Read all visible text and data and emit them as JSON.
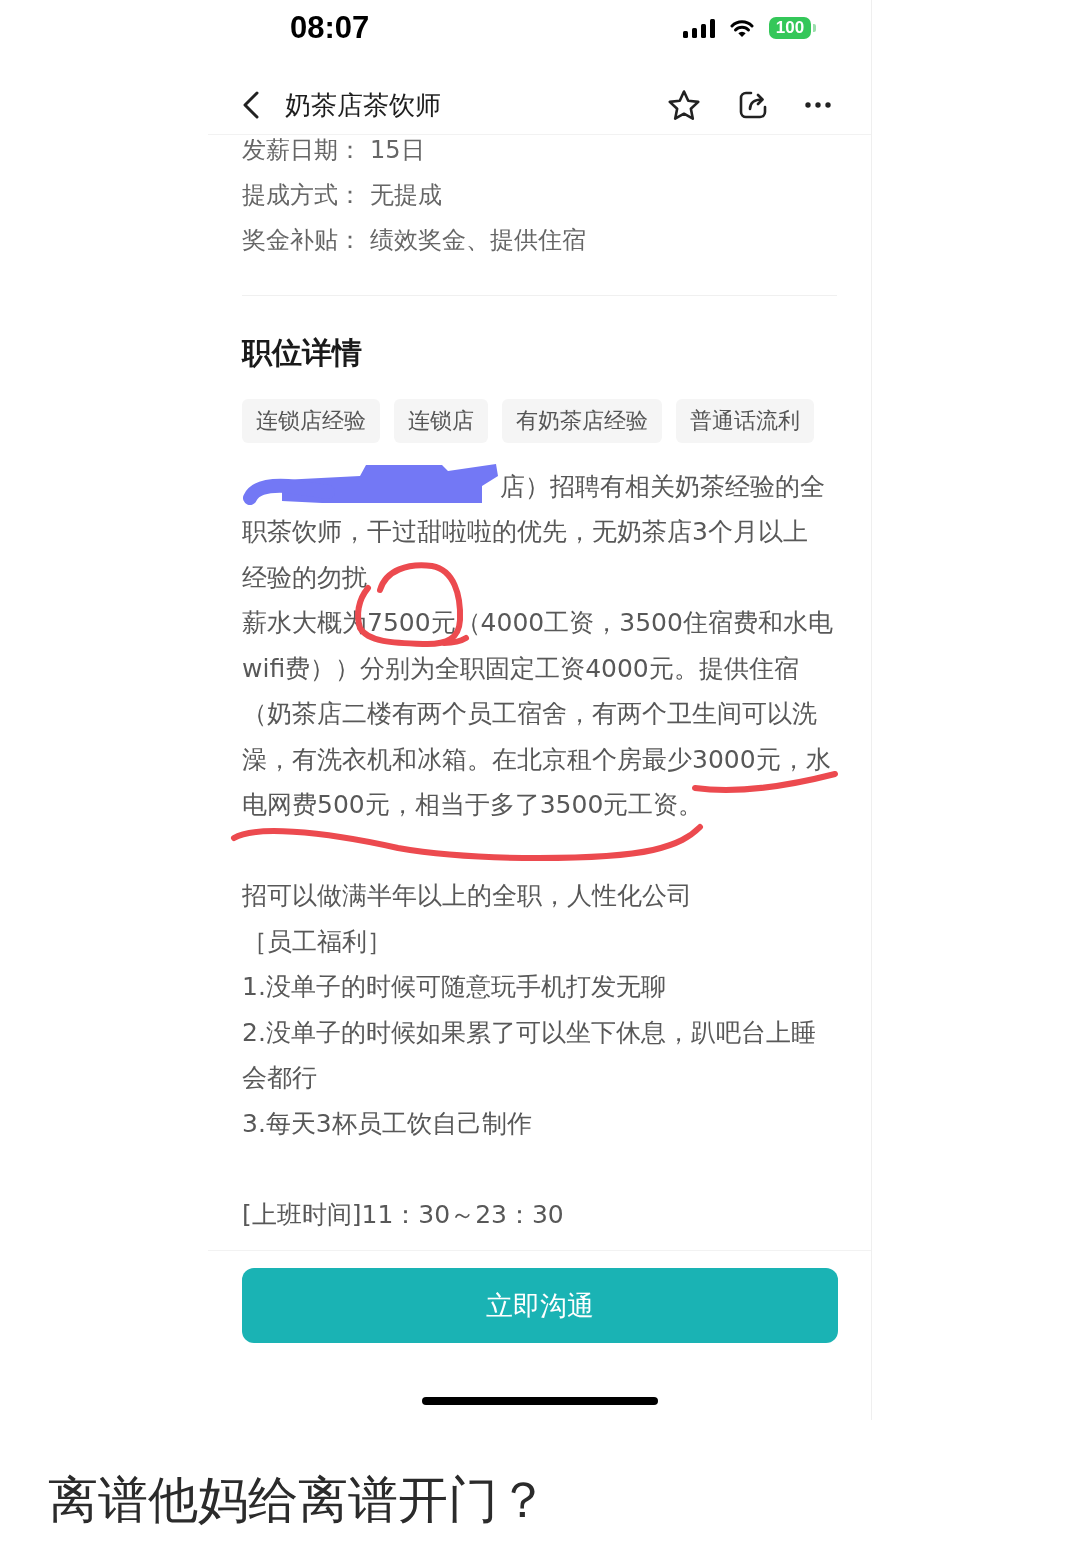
{
  "status_bar": {
    "time": "08:07",
    "battery": "100"
  },
  "nav_bar": {
    "title": "奶茶店茶饮师"
  },
  "info_rows": [
    {
      "label": "发薪日期：",
      "value": "15日"
    },
    {
      "label": "提成方式：",
      "value": "无提成"
    },
    {
      "label": "奖金补贴：",
      "value": "绩效奖金、提供住宿"
    }
  ],
  "job_details": {
    "title": "职位详情",
    "tags": [
      "连锁店经验",
      "连锁店",
      "有奶茶店经验",
      "普通话流利"
    ],
    "description": [
      {
        "redacted_line": {
          "visible_text": "店）招聘有相关奶茶经验的全"
        },
        "lines": [
          "职茶饮师，干过甜啦啦的优先，无奶茶店3个月以上",
          "经验的勿扰",
          "薪水大概为7500元（4000工资，3500住宿费和水电",
          "wifi费））分别为全职固定工资4000元。提供住宿",
          "（奶茶店二楼有两个员工宿舍，有两个卫生间可以洗",
          "澡，有洗衣机和冰箱。在北京租个房最少3000元，水",
          "电网费500元，相当于多了3500元工资。"
        ]
      },
      {
        "lines": [
          "招可以做满半年以上的全职，人性化公司",
          "［员工福利］",
          "1.没单子的时候可随意玩手机打发无聊",
          "2.没单子的时候如果累了可以坐下休息，趴吧台上睡",
          "会都行",
          "3.每天3杯员工饮自己制作"
        ]
      },
      {
        "lines": [
          "[上班时间]11：30～23：30"
        ]
      }
    ]
  },
  "action_button": {
    "label": "立即沟通"
  },
  "caption": "离谱他妈给离谱开门？"
}
